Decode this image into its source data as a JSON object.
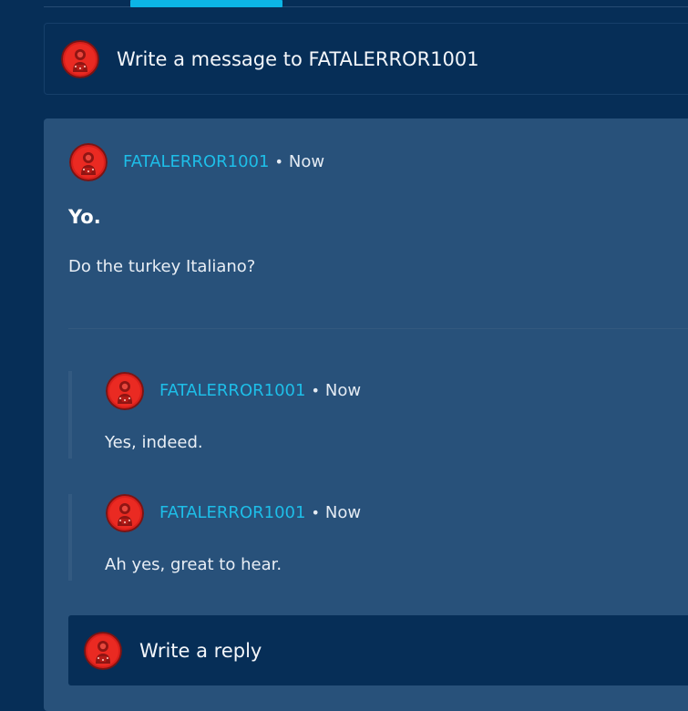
{
  "composer": {
    "placeholder": "Write a message to FATALERROR1001"
  },
  "post": {
    "author": "FATALERROR1001",
    "separator": "•",
    "time": "Now",
    "title": "Yo.",
    "body": "Do the turkey Italiano?"
  },
  "replies": [
    {
      "author": "FATALERROR1001",
      "separator": "•",
      "time": "Now",
      "text": "Yes, indeed."
    },
    {
      "author": "FATALERROR1001",
      "separator": "•",
      "time": "Now",
      "text": "Ah yes, great to hear."
    }
  ],
  "reply_box": {
    "placeholder": "Write a reply"
  },
  "colors": {
    "background": "#062e57",
    "card": "#28517a",
    "accent": "#0cb5e6",
    "username": "#1ebee8",
    "avatar_red": "#e0201c"
  },
  "icons": {
    "avatar": "user-avatar-icon"
  }
}
